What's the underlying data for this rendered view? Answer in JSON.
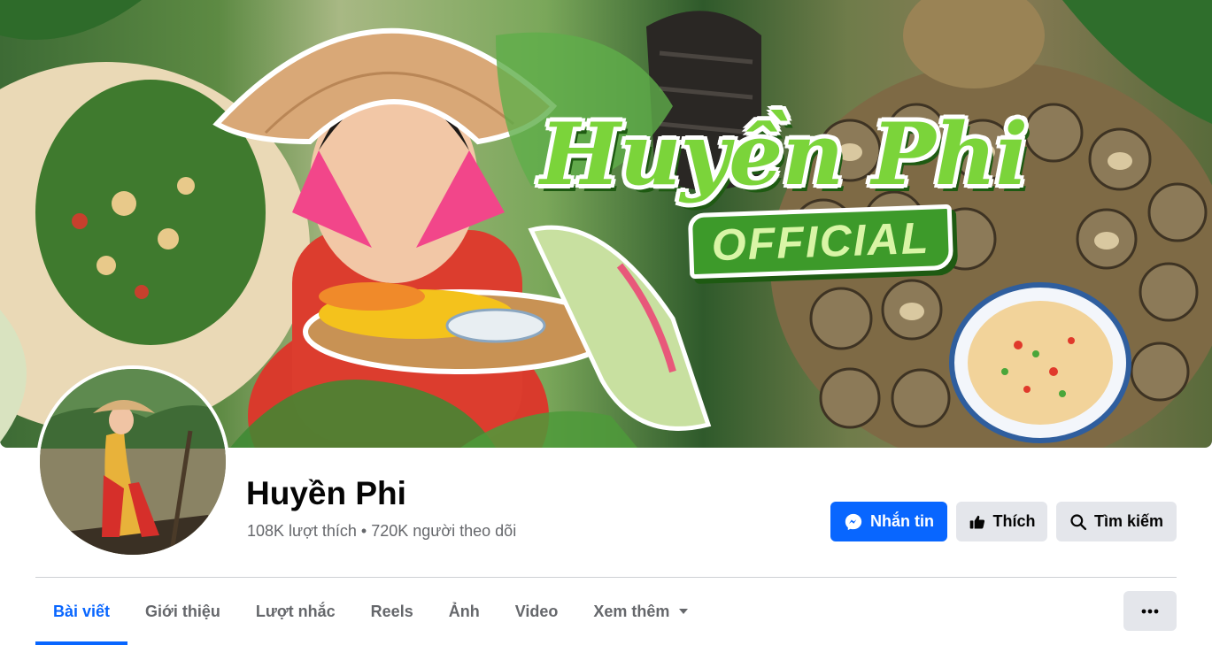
{
  "cover": {
    "title": "Huyền Phi",
    "badge": "OFFICIAL"
  },
  "page": {
    "name": "Huyền Phi",
    "stats": "108K lượt thích • 720K người theo dõi"
  },
  "actions": {
    "message_label": "Nhắn tin",
    "like_label": "Thích",
    "search_label": "Tìm kiếm"
  },
  "tabs": [
    {
      "label": "Bài viết",
      "active": true
    },
    {
      "label": "Giới thiệu",
      "active": false
    },
    {
      "label": "Lượt nhắc",
      "active": false
    },
    {
      "label": "Reels",
      "active": false
    },
    {
      "label": "Ảnh",
      "active": false
    },
    {
      "label": "Video",
      "active": false
    },
    {
      "label": "Xem thêm",
      "active": false
    }
  ],
  "colors": {
    "accent": "#0866ff",
    "secondary_button": "#e4e6eb",
    "muted_text": "#65676b",
    "brand_green": "#7bd43a"
  },
  "icons": {
    "message": "messenger-icon",
    "like": "thumbs-up-icon",
    "search": "search-icon",
    "dropdown": "caret-down-icon",
    "more": "more-horizontal-icon"
  }
}
